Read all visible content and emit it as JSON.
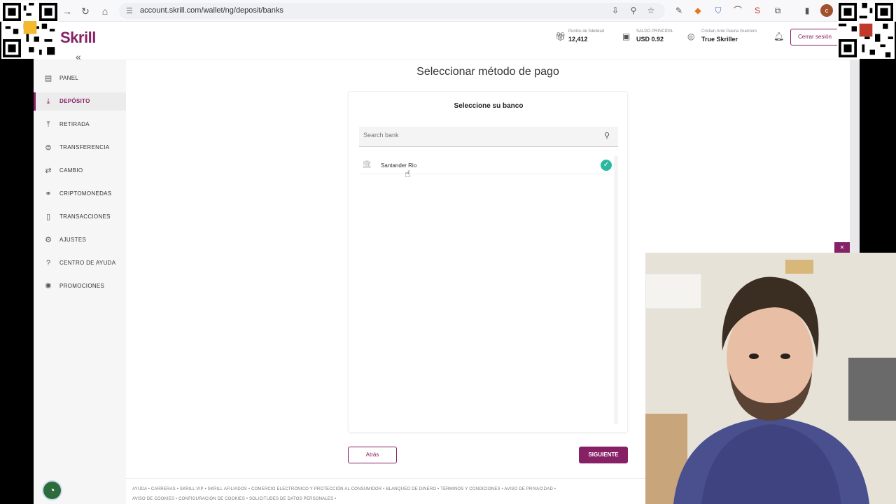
{
  "browser": {
    "url": "account.skrill.com/wallet/ng/deposit/banks"
  },
  "header": {
    "logo": "Skrill",
    "collapse_icon": "«",
    "loyalty_label": "Puntos de fidelidad",
    "loyalty_value": "12,412",
    "balance_label": "SALDO PRINCIPAL",
    "balance_value": "USD 0.92",
    "user_name_small": "Cristian Ariel Gauna Guerrero",
    "user_tier": "True Skriller",
    "logout_label": "Cerrar sesión"
  },
  "sidebar": {
    "items": [
      {
        "label": "PANEL",
        "icon": "panel-icon"
      },
      {
        "label": "DEPÓSITO",
        "icon": "deposit-icon"
      },
      {
        "label": "RETIRADA",
        "icon": "withdraw-icon"
      },
      {
        "label": "TRANSFERENCIA",
        "icon": "transfer-icon"
      },
      {
        "label": "CAMBIO",
        "icon": "exchange-icon"
      },
      {
        "label": "CRIPTOMONEDAS",
        "icon": "crypto-icon"
      },
      {
        "label": "TRANSACCIONES",
        "icon": "transactions-icon"
      },
      {
        "label": "AJUSTES",
        "icon": "settings-icon"
      },
      {
        "label": "CENTRO DE AYUDA",
        "icon": "help-icon"
      },
      {
        "label": "PROMOCIONES",
        "icon": "promotions-icon"
      }
    ],
    "active_index": 1
  },
  "main": {
    "title": "Seleccionar método de pago",
    "card_title": "Seleccione su banco",
    "search_placeholder": "Search bank",
    "banks": [
      {
        "name": "Santander Rio",
        "selected": true
      }
    ],
    "back_label": "Atrás",
    "next_label": "SIGUIENTE"
  },
  "footer": {
    "line1": "AYUDA  •  CARRERAS  •  SKRILL VIP  •  SKRILL AFILIADOS  •  COMERCIO ELECTRÓNICO Y PROTECCIÓN AL CONSUMIDOR  •  BLANQUEO DE DINERO  •  TÉRMINOS Y CONDICIONES  •  AVISO DE PRIVACIDAD  •",
    "line2": "AVISO DE COOKIES  •  CONFIGURACIÓN DE COOKIES  •  SOLICITUDES DE DATOS PERSONALES  •"
  },
  "colors": {
    "brand": "#862165",
    "check": "#2ab9a0"
  }
}
